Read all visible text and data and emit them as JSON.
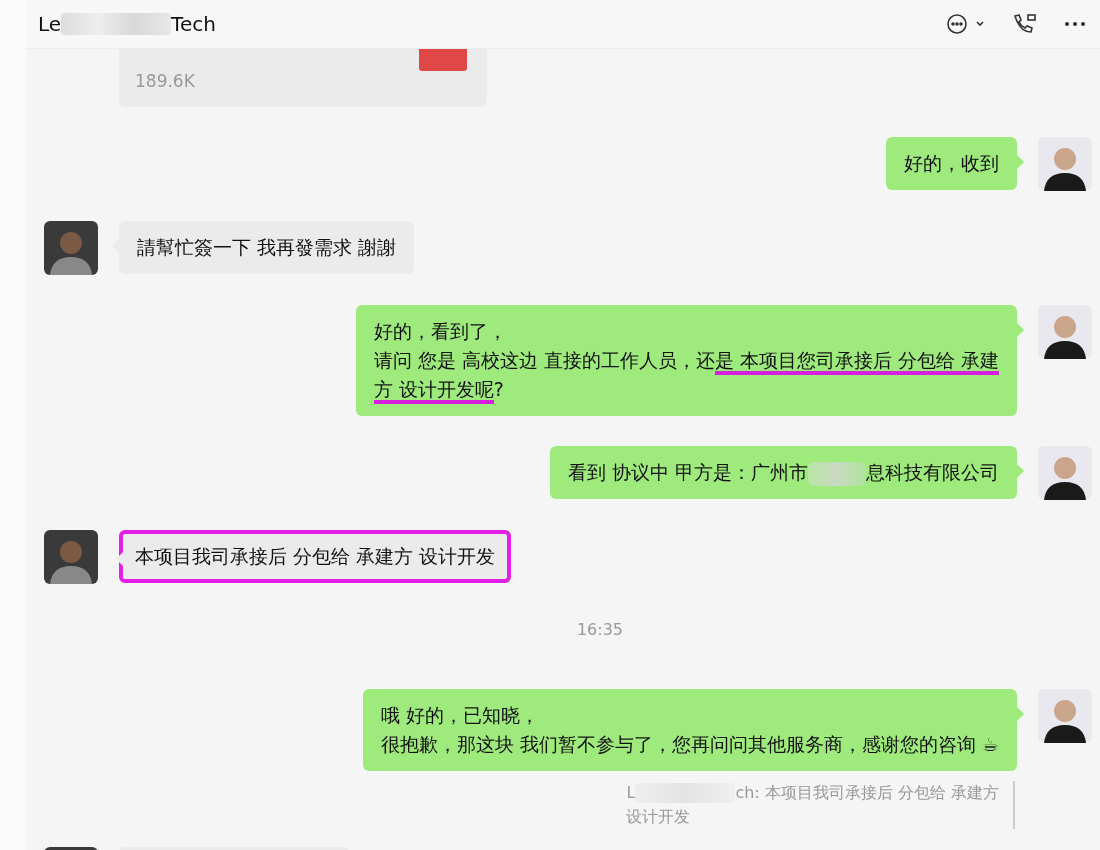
{
  "header": {
    "title_parts": [
      "Le",
      "Tech"
    ]
  },
  "messages": [
    {
      "kind": "file",
      "size": "189.6K"
    },
    {
      "kind": "sent",
      "highlighted": false,
      "lines": [
        [
          {
            "text": "好的，收到",
            "underlined": false,
            "blur_before": false
          }
        ]
      ]
    },
    {
      "kind": "received",
      "highlighted": false,
      "lines": [
        [
          {
            "text": "請幫忙簽一下 我再發需求 謝謝",
            "underlined": false,
            "blur_before": false
          }
        ]
      ]
    },
    {
      "kind": "sent",
      "highlighted": false,
      "lines": [
        [
          {
            "text": "好的，看到了，",
            "underlined": false,
            "blur_before": false
          }
        ],
        [
          {
            "text": "请问 您是 高校这边 直接的工作人员，还",
            "underlined": false,
            "blur_before": false
          },
          {
            "text": "是 本项目您司承接后 分包给 承建",
            "underlined": true,
            "blur_before": false
          }
        ],
        [
          {
            "text": "方 设计开发呢",
            "underlined": true,
            "blur_before": false
          },
          {
            "text": "?",
            "underlined": false,
            "blur_before": false
          }
        ]
      ]
    },
    {
      "kind": "sent",
      "highlighted": false,
      "lines": [
        [
          {
            "text": "看到 协议中 甲方是：广州市",
            "underlined": false,
            "blur_before": false
          },
          {
            "text": "息科技有限公司",
            "underlined": false,
            "blur_before": true
          }
        ]
      ]
    },
    {
      "kind": "received",
      "highlighted": true,
      "lines": [
        [
          {
            "text": "本项目我司承接后 分包给 承建方 设计开发",
            "underlined": false,
            "blur_before": false
          }
        ]
      ]
    },
    {
      "kind": "time",
      "text": "16:35"
    },
    {
      "kind": "sent",
      "highlighted": false,
      "lines": [
        [
          {
            "text": "哦 好的，已知晓，",
            "underlined": false,
            "blur_before": false
          }
        ],
        [
          {
            "text": "很抱歉，那这块 我们暂不参与了，您再问问其他服务商，感谢您的咨询 ☕",
            "underlined": false,
            "blur_before": false
          }
        ]
      ],
      "quote": {
        "sender_start": "L",
        "lines": [
          "ch: 本项目我司承接后 分包给 承建方",
          "设计开发"
        ]
      }
    },
    {
      "kind": "partial"
    }
  ]
}
